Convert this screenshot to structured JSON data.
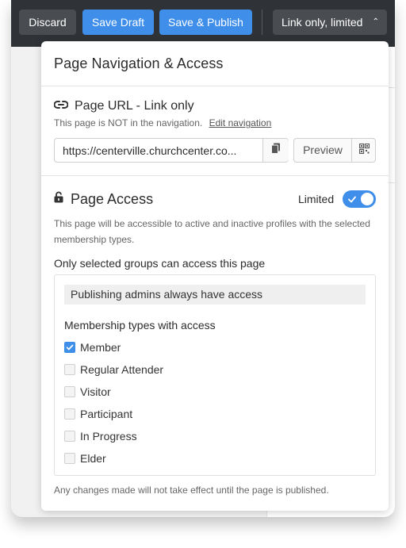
{
  "toolbar": {
    "discard_label": "Discard",
    "save_draft_label": "Save Draft",
    "save_publish_label": "Save & Publish",
    "link_dropdown_label": "Link only, limited",
    "link_dropdown_chevron": "⌃"
  },
  "popover": {
    "title": "Page Navigation & Access",
    "url_section": {
      "title": "Page URL - Link only",
      "nav_note": "This page is NOT in the navigation.",
      "edit_nav_link": "Edit navigation",
      "url_value": "https://centerville.churchcenter.co...",
      "preview_label": "Preview"
    },
    "access_section": {
      "title": "Page Access",
      "toggle_label": "Limited",
      "toggle_on": true,
      "description": "This page will be accessible to active and inactive profiles with the selected membership types.",
      "groups_label": "Only selected groups can access this page",
      "admin_note": "Publishing admins always have access",
      "membership_heading": "Membership types with access",
      "membership_types": [
        {
          "label": "Member",
          "checked": true
        },
        {
          "label": "Regular Attender",
          "checked": false
        },
        {
          "label": "Visitor",
          "checked": false
        },
        {
          "label": "Participant",
          "checked": false
        },
        {
          "label": "In Progress",
          "checked": false
        },
        {
          "label": "Elder",
          "checked": false
        }
      ]
    },
    "footer_note": "Any changes made will not take effect until the page is published."
  },
  "colors": {
    "accent": "#3f8eea",
    "topbar": "#2f3236",
    "button_dark": "#494c51"
  },
  "icons": {
    "url": "link-icon",
    "copy": "copy-icon",
    "qr": "qr-code-icon",
    "access": "lock-icon",
    "toggle_check": "check-icon"
  }
}
